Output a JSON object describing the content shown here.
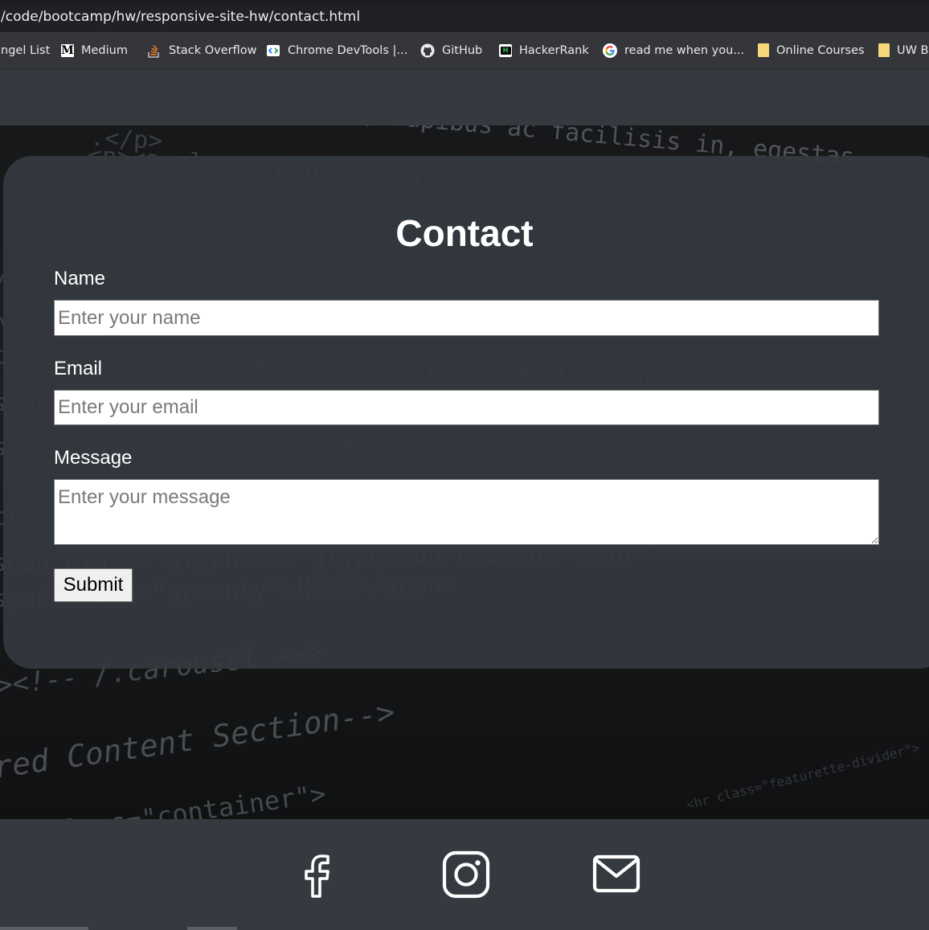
{
  "browser": {
    "url": "/code/bootcamp/hw/responsive-site-hw/contact.html",
    "bookmarks": [
      {
        "label": "ngel List",
        "icon": "none"
      },
      {
        "label": "Medium",
        "icon": "medium-icon"
      },
      {
        "label": "Stack Overflow",
        "icon": "stack-overflow-icon"
      },
      {
        "label": "Chrome DevTools |...",
        "icon": "chrome-devtools-icon"
      },
      {
        "label": "GitHub",
        "icon": "github-icon"
      },
      {
        "label": "HackerRank",
        "icon": "hackerrank-icon"
      },
      {
        "label": "read me when you...",
        "icon": "google-icon"
      },
      {
        "label": "Online Courses",
        "icon": "folder-icon"
      },
      {
        "label": "UW B",
        "icon": "folder-icon"
      }
    ]
  },
  "contact": {
    "title": "Contact",
    "name_label": "Name",
    "name_placeholder": "Enter your name",
    "email_label": "Email",
    "email_placeholder": "Enter your email",
    "message_label": "Message",
    "message_placeholder": "Enter your message",
    "submit_label": "Submit"
  },
  "footer": {
    "icons": [
      "facebook-icon",
      "instagram-icon",
      "mail-icon"
    ]
  },
  "colors": {
    "navbar": "#353940",
    "card": "#353940",
    "footer": "#353940",
    "text": "#ffffff"
  }
}
